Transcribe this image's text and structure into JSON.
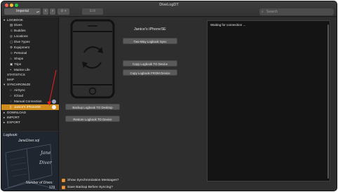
{
  "window": {
    "title": "DiveLogDT"
  },
  "toolbar": {
    "units_select": "Imperial",
    "back_glyph": "‹",
    "forward_glyph": "›",
    "gear_glyph": "⚙ ▾",
    "edit_label": "Edit",
    "search_placeholder": "Search"
  },
  "sidebar": {
    "logbook_header": "LOGBOOK",
    "logbook_items": [
      "Dives",
      "Buddies",
      "Locations",
      "Dive Types",
      "Equipment",
      "Personal",
      "Shops",
      "Trips",
      "Marine Life"
    ],
    "statistics": "STATISTICS",
    "map": "MAP",
    "sync_header": "SYNCHRONIZE",
    "sync_items": [
      "AirSync",
      "iCloud",
      "Manual Connection",
      "Janice's iPhoneSE"
    ],
    "download": "DOWNLOAD",
    "import": "IMPORT",
    "export": "EXPORT"
  },
  "logbook_info": {
    "label": "Logbook:",
    "name": "JaneDiver.sql",
    "cover_line1": "Jane",
    "cover_line2": "Diver",
    "dives_label": "Number of Dives:",
    "dives_count": "129"
  },
  "device": {
    "name": "Janice's iPhoneSE",
    "two_way": "Two-Way Logbook Sync",
    "copy_to": "Copy Logbook TO Device",
    "copy_from": "Copy Logbook FROM Device",
    "backup": "Backup Logbook TO Desktop",
    "restore": "Restore Logbook TO Device"
  },
  "log": {
    "status": "Waiting for connection ..."
  },
  "options": {
    "show_messages": "Show Synchronization Messages?",
    "save_backup": "Save Backup Before Syncing?"
  },
  "colors": {
    "accent": "#d08d1e",
    "background": "#2e2e2e",
    "sidebar": "#232323"
  }
}
